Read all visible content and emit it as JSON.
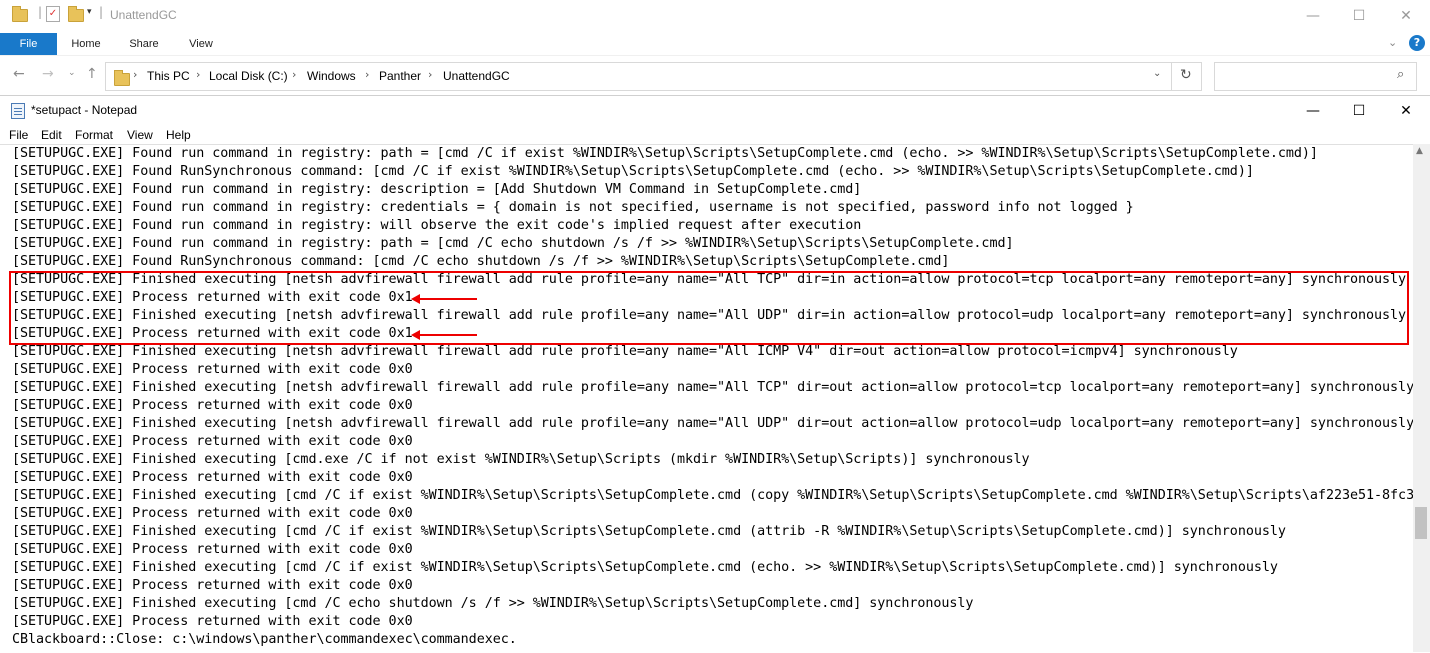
{
  "explorer": {
    "title": "UnattendGC",
    "ribbon_tabs": [
      "File",
      "Home",
      "Share",
      "View"
    ],
    "breadcrumb": [
      "This PC",
      "Local Disk (C:)",
      "Windows",
      "Panther",
      "UnattendGC"
    ],
    "search_placeholder": "",
    "help_label": "?"
  },
  "notepad": {
    "title": "*setupact - Notepad",
    "menu": [
      "File",
      "Edit",
      "Format",
      "View",
      "Help"
    ],
    "lines": [
      "[SETUPUGC.EXE] Found run command in registry: path = [cmd /C if exist %WINDIR%\\Setup\\Scripts\\SetupComplete.cmd (echo. >> %WINDIR%\\Setup\\Scripts\\SetupComplete.cmd)]",
      "[SETUPUGC.EXE] Found RunSynchronous command: [cmd /C if exist %WINDIR%\\Setup\\Scripts\\SetupComplete.cmd (echo. >> %WINDIR%\\Setup\\Scripts\\SetupComplete.cmd)]",
      "[SETUPUGC.EXE] Found run command in registry: description = [Add Shutdown VM Command in SetupComplete.cmd]",
      "[SETUPUGC.EXE] Found run command in registry: credentials = { domain is not specified, username is not specified, password info not logged }",
      "[SETUPUGC.EXE] Found run command in registry: will observe the exit code's implied request after execution",
      "[SETUPUGC.EXE] Found run command in registry: path = [cmd /C echo shutdown /s /f >> %WINDIR%\\Setup\\Scripts\\SetupComplete.cmd]",
      "[SETUPUGC.EXE] Found RunSynchronous command: [cmd /C echo shutdown /s /f >> %WINDIR%\\Setup\\Scripts\\SetupComplete.cmd]",
      "[SETUPUGC.EXE] Finished executing [netsh advfirewall firewall add rule profile=any name=\"All TCP\" dir=in action=allow protocol=tcp localport=any remoteport=any] synchronously",
      "[SETUPUGC.EXE] Process returned with exit code 0x1",
      "[SETUPUGC.EXE] Finished executing [netsh advfirewall firewall add rule profile=any name=\"All UDP\" dir=in action=allow protocol=udp localport=any remoteport=any] synchronously",
      "[SETUPUGC.EXE] Process returned with exit code 0x1",
      "[SETUPUGC.EXE] Finished executing [netsh advfirewall firewall add rule profile=any name=\"All ICMP V4\" dir=out action=allow protocol=icmpv4] synchronously",
      "[SETUPUGC.EXE] Process returned with exit code 0x0",
      "[SETUPUGC.EXE] Finished executing [netsh advfirewall firewall add rule profile=any name=\"All TCP\" dir=out action=allow protocol=tcp localport=any remoteport=any] synchronously",
      "[SETUPUGC.EXE] Process returned with exit code 0x0",
      "[SETUPUGC.EXE] Finished executing [netsh advfirewall firewall add rule profile=any name=\"All UDP\" dir=out action=allow protocol=udp localport=any remoteport=any] synchronously",
      "[SETUPUGC.EXE] Process returned with exit code 0x0",
      "[SETUPUGC.EXE] Finished executing [cmd.exe /C if not exist %WINDIR%\\Setup\\Scripts (mkdir %WINDIR%\\Setup\\Scripts)] synchronously",
      "[SETUPUGC.EXE] Process returned with exit code 0x0",
      "[SETUPUGC.EXE] Finished executing [cmd /C if exist %WINDIR%\\Setup\\Scripts\\SetupComplete.cmd (copy %WINDIR%\\Setup\\Scripts\\SetupComplete.cmd %WINDIR%\\Setup\\Scripts\\af223e51-8fc3",
      "[SETUPUGC.EXE] Process returned with exit code 0x0",
      "[SETUPUGC.EXE] Finished executing [cmd /C if exist %WINDIR%\\Setup\\Scripts\\SetupComplete.cmd (attrib -R %WINDIR%\\Setup\\Scripts\\SetupComplete.cmd)] synchronously",
      "[SETUPUGC.EXE] Process returned with exit code 0x0",
      "[SETUPUGC.EXE] Finished executing [cmd /C if exist %WINDIR%\\Setup\\Scripts\\SetupComplete.cmd (echo. >> %WINDIR%\\Setup\\Scripts\\SetupComplete.cmd)] synchronously",
      "[SETUPUGC.EXE] Process returned with exit code 0x0",
      "[SETUPUGC.EXE] Finished executing [cmd /C echo shutdown /s /f >> %WINDIR%\\Setup\\Scripts\\SetupComplete.cmd] synchronously",
      "[SETUPUGC.EXE] Process returned with exit code 0x0",
      "CBlackboard::Close: c:\\windows\\panther\\commandexec\\commandexec."
    ]
  },
  "colors": {
    "accent": "#1979ca",
    "annotation": "#ee0000"
  }
}
